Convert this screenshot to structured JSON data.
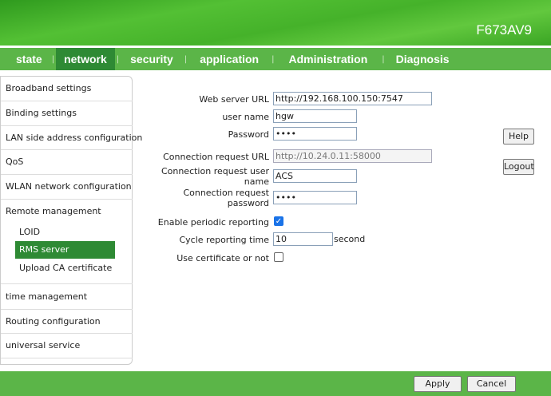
{
  "header": {
    "model": "F673AV9"
  },
  "nav": {
    "tabs": [
      "state",
      "network",
      "security",
      "application",
      "Administration",
      "Diagnosis"
    ],
    "active": "network"
  },
  "sidebar": {
    "items": [
      "Broadband settings",
      "Binding settings",
      "LAN side address configuration",
      "QoS",
      "WLAN network configuration",
      "Remote management"
    ],
    "sub_items": [
      "LOID",
      "RMS server",
      "Upload CA certificate"
    ],
    "items2": [
      "time management",
      "Routing configuration",
      "universal service"
    ]
  },
  "form": {
    "web_url_label": "Web server URL",
    "web_url": "http://192.168.100.150:7547",
    "user_label": "user name",
    "user": "hgw",
    "pass_label": "Password",
    "pass": "••••",
    "conn_url_label": "Connection request URL",
    "conn_url": "http://10.24.0.11:58000",
    "conn_user_label1": "Connection request user",
    "conn_user_label2": "name",
    "conn_user": "ACS",
    "conn_pass_label1": "Connection request",
    "conn_pass_label2": "password",
    "conn_pass": "••••",
    "periodic_label": "Enable periodic reporting",
    "periodic_checked": true,
    "cycle_label": "Cycle reporting time",
    "cycle": "10",
    "cycle_unit": "second",
    "cert_label": "Use certificate or not",
    "cert_checked": false
  },
  "buttons": {
    "help": "Help",
    "logout": "Logout",
    "apply": "Apply",
    "cancel": "Cancel"
  }
}
